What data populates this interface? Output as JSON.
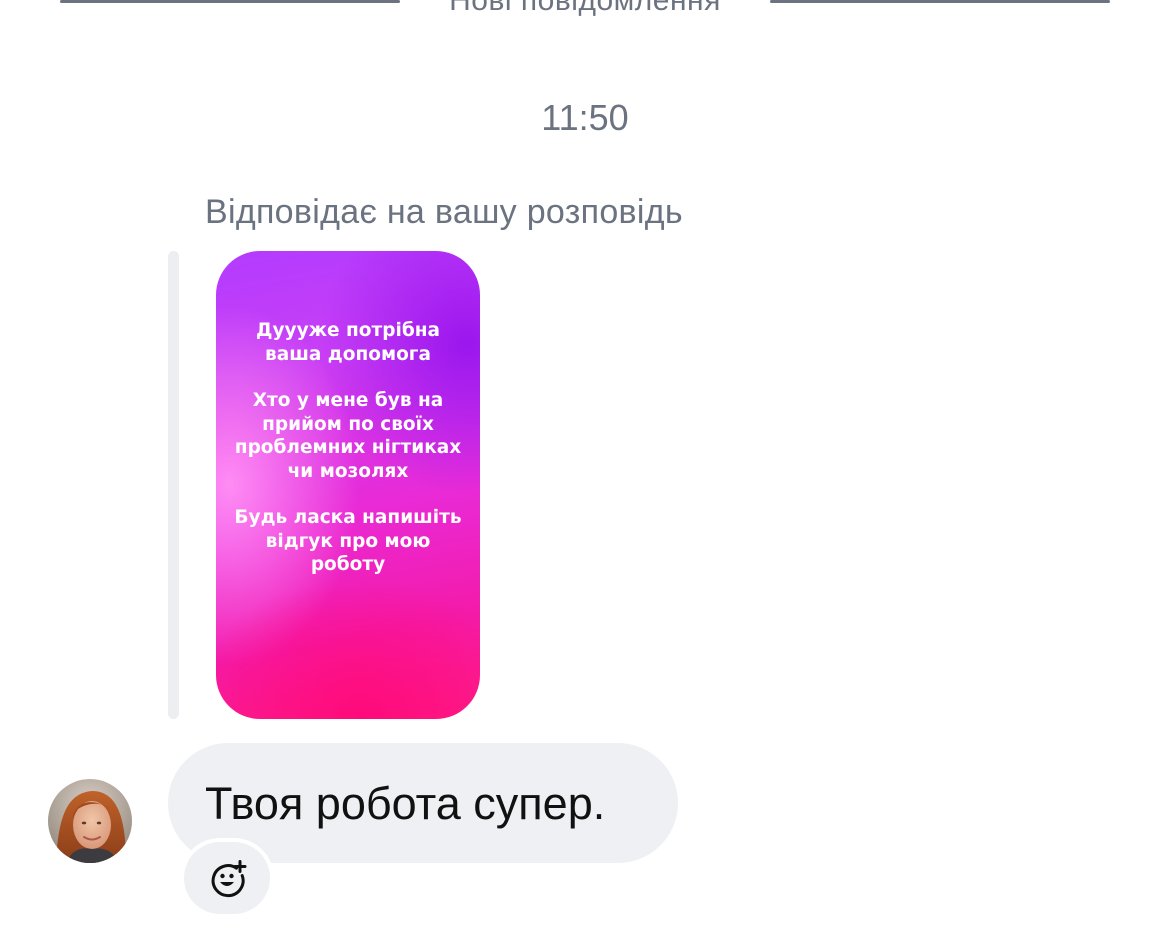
{
  "divider": {
    "label": "Нові повідомлення"
  },
  "thread": {
    "timestamp": "11:50",
    "reply_context": "Відповідає на вашу розповідь"
  },
  "story": {
    "paragraphs": [
      "Дуууже потрібна ваша допомога",
      "Хто у мене був на прийом по своїх проблемних нігтиках чи мозолях",
      "Будь ласка напишіть відгук про мою роботу"
    ]
  },
  "message": {
    "text": "Твоя робота супер."
  },
  "icons": {
    "reaction": "add-reaction-icon",
    "avatar": "avatar"
  },
  "colors": {
    "bubble_bg": "#eef0f4",
    "secondary_text": "#6b7280",
    "story_gradient_top": "#b33bff",
    "story_gradient_bottom": "#ff1f86"
  }
}
